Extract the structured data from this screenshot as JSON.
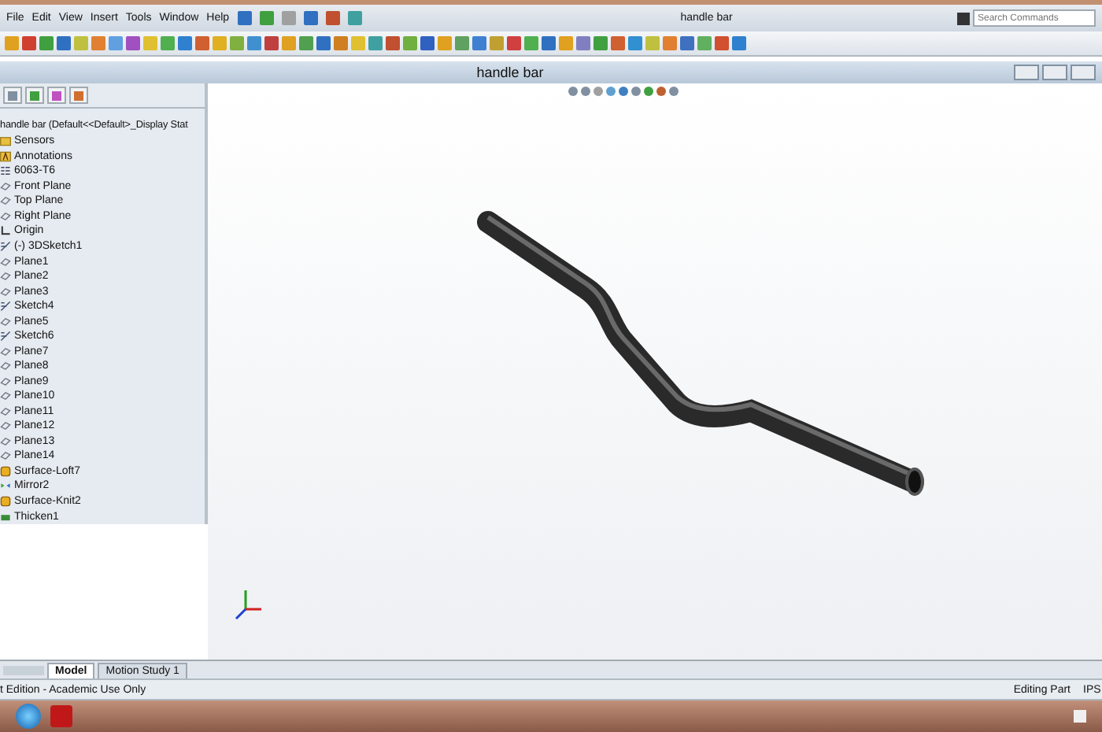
{
  "window": {
    "title": "handle bar"
  },
  "menu": [
    "File",
    "Edit",
    "View",
    "Insert",
    "Tools",
    "Window",
    "Help"
  ],
  "search": {
    "placeholder": "Search Commands"
  },
  "document": {
    "title": "handle bar"
  },
  "tree": {
    "root": "handle bar  (Default<<Default>_Display Stat",
    "items": [
      {
        "label": "Sensors",
        "kind": "folder"
      },
      {
        "label": "Annotations",
        "kind": "annotation"
      },
      {
        "label": "6063-T6",
        "kind": "material"
      },
      {
        "label": "Front Plane",
        "kind": "plane"
      },
      {
        "label": "Top Plane",
        "kind": "plane"
      },
      {
        "label": "Right Plane",
        "kind": "plane"
      },
      {
        "label": "Origin",
        "kind": "origin"
      },
      {
        "label": "(-) 3DSketch1",
        "kind": "sketch"
      },
      {
        "label": "Plane1",
        "kind": "plane"
      },
      {
        "label": "Plane2",
        "kind": "plane"
      },
      {
        "label": "Plane3",
        "kind": "plane"
      },
      {
        "label": "Sketch4",
        "kind": "sketch"
      },
      {
        "label": "Plane5",
        "kind": "plane"
      },
      {
        "label": "Sketch6",
        "kind": "sketch"
      },
      {
        "label": "Plane7",
        "kind": "plane"
      },
      {
        "label": "Plane8",
        "kind": "plane"
      },
      {
        "label": "Plane9",
        "kind": "plane"
      },
      {
        "label": "Plane10",
        "kind": "plane"
      },
      {
        "label": "Plane11",
        "kind": "plane"
      },
      {
        "label": "Plane12",
        "kind": "plane"
      },
      {
        "label": "Plane13",
        "kind": "plane"
      },
      {
        "label": "Plane14",
        "kind": "plane"
      },
      {
        "label": "Surface-Loft7",
        "kind": "surface"
      },
      {
        "label": "Mirror2",
        "kind": "mirror"
      },
      {
        "label": "Surface-Knit2",
        "kind": "surface"
      },
      {
        "label": "Thicken1",
        "kind": "thicken"
      }
    ]
  },
  "tabs": [
    {
      "label": "Model",
      "selected": true
    },
    {
      "label": "Motion Study 1",
      "selected": false
    }
  ],
  "status_bar": {
    "left": "t Edition - Academic Use Only",
    "mode": "Editing Part",
    "units": "IPS"
  }
}
